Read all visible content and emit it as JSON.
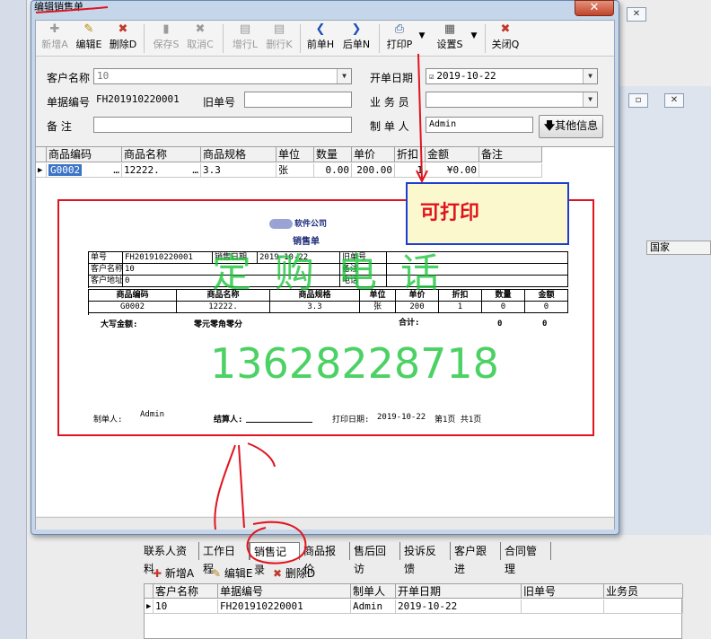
{
  "window": {
    "title": "编辑销售单",
    "close_glyph": "✕"
  },
  "background": {
    "close_glyph": "✕",
    "restore_glyph": "▫",
    "col_country": "国家"
  },
  "toolbar": [
    {
      "label": "新增A",
      "icon": "add-icon",
      "glyph": "✚",
      "disabled": true
    },
    {
      "label": "编辑E",
      "icon": "edit-icon",
      "glyph": "✎",
      "disabled": false
    },
    {
      "label": "删除D",
      "icon": "delete-icon",
      "glyph": "✖",
      "disabled": false
    },
    {
      "label": "保存S",
      "icon": "save-icon",
      "glyph": "▮",
      "disabled": true
    },
    {
      "label": "取消C",
      "icon": "cancel-icon",
      "glyph": "✖",
      "disabled": true
    },
    {
      "label": "增行L",
      "icon": "add-row-icon",
      "glyph": "▤",
      "disabled": true
    },
    {
      "label": "删行K",
      "icon": "delete-row-icon",
      "glyph": "▤",
      "disabled": true
    },
    {
      "label": "前单H",
      "icon": "prev-icon",
      "glyph": "❮",
      "disabled": false
    },
    {
      "label": "后单N",
      "icon": "next-icon",
      "glyph": "❯",
      "disabled": false
    },
    {
      "label": "打印P",
      "icon": "print-icon",
      "glyph": "⎙",
      "disabled": false
    },
    {
      "label": "设置S",
      "icon": "settings-icon",
      "glyph": "▦",
      "disabled": false
    },
    {
      "label": "关闭Q",
      "icon": "close-icon",
      "glyph": "✖",
      "disabled": false
    }
  ],
  "form": {
    "customer_label": "客户名称",
    "customer_value": "10",
    "doc_no_label": "单据编号",
    "doc_no_value": "FH201910220001",
    "old_no_label": "旧单号",
    "old_no_value": "",
    "note_label": "备  注",
    "note_value": "",
    "date_label": "开单日期",
    "date_value": "2019-10-22",
    "salesman_label": "业 务 员",
    "salesman_value": "",
    "maker_label": "制 单 人",
    "maker_value": "Admin",
    "other_button": "其他信息"
  },
  "grid": {
    "columns": [
      "商品编码",
      "商品名称",
      "商品规格",
      "单位",
      "数量",
      "单价",
      "折扣",
      "金额",
      "备注"
    ],
    "row": [
      "G0002",
      "12222.",
      "3.3",
      "张",
      "0.00",
      "200.00",
      "1",
      "¥0.00",
      ""
    ],
    "ellipsis": "…"
  },
  "report": {
    "company": "软件公司",
    "title": "销售单",
    "header_rows": [
      [
        "单号",
        "FH201910220001",
        "销售日期",
        "2019-10-22",
        "旧单号",
        ""
      ],
      [
        "客户名称",
        "10",
        "",
        "",
        "备注",
        ""
      ],
      [
        "客户地址",
        "0",
        "",
        "",
        "电话",
        ""
      ]
    ],
    "columns": [
      "商品编码",
      "商品名称",
      "商品规格",
      "单位",
      "单价",
      "折扣",
      "数量",
      "金额"
    ],
    "row": [
      "G0002",
      "12222.",
      "3.3",
      "张",
      "200",
      "1",
      "0",
      "0"
    ],
    "total_words_label": "大写金额:",
    "total_words_value": "零元零角零分",
    "total_label": "合计:",
    "total_qty": "0",
    "total_amount": "0",
    "maker_label": "制单人:",
    "maker_value": "Admin",
    "settler_label": "结算人:",
    "print_date_label": "打印日期:",
    "print_date_value": "2019-10-22",
    "page_info": "第1页 共1页"
  },
  "watermark": {
    "text": "定 购 电 话",
    "phone": "13628228718"
  },
  "callout": "可打印",
  "tabs": [
    "联系人资料",
    "工作日程",
    "销售记录",
    "商品报价",
    "售后回访",
    "投诉反馈",
    "客户跟进",
    "合同管理"
  ],
  "active_tab": "销售记录",
  "subtoolbar": [
    {
      "label": "新增A",
      "icon": "add-icon",
      "glyph": "✚"
    },
    {
      "label": "编辑E",
      "icon": "edit-icon",
      "glyph": "✎"
    },
    {
      "label": "删除D",
      "icon": "delete-icon",
      "glyph": "✖"
    }
  ],
  "bottom_table": {
    "columns": [
      "客户名称",
      "单据编号",
      "制单人",
      "开单日期",
      "旧单号",
      "业务员"
    ],
    "row": [
      "10",
      "FH201910220001",
      "Admin",
      "2019-10-22",
      "",
      ""
    ]
  },
  "colors": {
    "annotation_red": "#e0141e",
    "callout_border": "#1c3fd1",
    "watermark_green": "#1ac438",
    "callout_fill": "#fcf8cd"
  }
}
